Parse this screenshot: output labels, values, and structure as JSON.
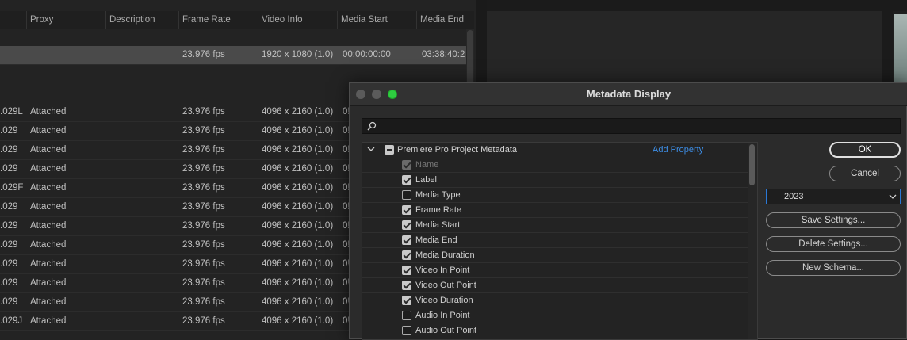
{
  "project_panel": {
    "columns": [
      "Proxy",
      "Description",
      "Frame Rate",
      "Video Info",
      "Media Start",
      "Media End"
    ],
    "selected_row": {
      "frame_rate": "23.976 fps",
      "video_info": "1920 x 1080 (1.0)",
      "media_start": "00:00:00:00",
      "media_end": "03:38:40:2"
    },
    "rows": [
      {
        "name": ".029L",
        "proxy": "Attached",
        "frame_rate": "23.976 fps",
        "video_info": "4096 x 2160 (1.0)",
        "start": "0!"
      },
      {
        "name": ".029",
        "proxy": "Attached",
        "frame_rate": "23.976 fps",
        "video_info": "4096 x 2160 (1.0)",
        "start": "0!"
      },
      {
        "name": ".029",
        "proxy": "Attached",
        "frame_rate": "23.976 fps",
        "video_info": "4096 x 2160 (1.0)",
        "start": "0!"
      },
      {
        "name": ".029",
        "proxy": "Attached",
        "frame_rate": "23.976 fps",
        "video_info": "4096 x 2160 (1.0)",
        "start": "0!"
      },
      {
        "name": ".029F",
        "proxy": "Attached",
        "frame_rate": "23.976 fps",
        "video_info": "4096 x 2160 (1.0)",
        "start": "0!"
      },
      {
        "name": ".029",
        "proxy": "Attached",
        "frame_rate": "23.976 fps",
        "video_info": "4096 x 2160 (1.0)",
        "start": "0!"
      },
      {
        "name": ".029",
        "proxy": "Attached",
        "frame_rate": "23.976 fps",
        "video_info": "4096 x 2160 (1.0)",
        "start": "0!"
      },
      {
        "name": ".029",
        "proxy": "Attached",
        "frame_rate": "23.976 fps",
        "video_info": "4096 x 2160 (1.0)",
        "start": "0!"
      },
      {
        "name": ".029",
        "proxy": "Attached",
        "frame_rate": "23.976 fps",
        "video_info": "4096 x 2160 (1.0)",
        "start": "0!"
      },
      {
        "name": ".029",
        "proxy": "Attached",
        "frame_rate": "23.976 fps",
        "video_info": "4096 x 2160 (1.0)",
        "start": "0!"
      },
      {
        "name": ".029",
        "proxy": "Attached",
        "frame_rate": "23.976 fps",
        "video_info": "4096 x 2160 (1.0)",
        "start": "0!"
      },
      {
        "name": ".029J",
        "proxy": "Attached",
        "frame_rate": "23.976 fps",
        "video_info": "4096 x 2160 (1.0)",
        "start": "0!"
      }
    ]
  },
  "dialog": {
    "title": "Metadata Display",
    "search_placeholder": "",
    "group_label": "Premiere Pro Project Metadata",
    "add_property": "Add Property",
    "properties": [
      {
        "label": "Name",
        "checked": true,
        "disabled": true
      },
      {
        "label": "Label",
        "checked": true,
        "disabled": false
      },
      {
        "label": "Media Type",
        "checked": false,
        "disabled": false
      },
      {
        "label": "Frame Rate",
        "checked": true,
        "disabled": false
      },
      {
        "label": "Media Start",
        "checked": true,
        "disabled": false
      },
      {
        "label": "Media End",
        "checked": true,
        "disabled": false
      },
      {
        "label": "Media Duration",
        "checked": true,
        "disabled": false
      },
      {
        "label": "Video In Point",
        "checked": true,
        "disabled": false
      },
      {
        "label": "Video Out Point",
        "checked": true,
        "disabled": false
      },
      {
        "label": "Video Duration",
        "checked": true,
        "disabled": false
      },
      {
        "label": "Audio In Point",
        "checked": false,
        "disabled": false
      },
      {
        "label": "Audio Out Point",
        "checked": false,
        "disabled": false
      }
    ],
    "ok_label": "OK",
    "cancel_label": "Cancel",
    "version_value": "2023",
    "save_label": "Save Settings...",
    "delete_label": "Delete Settings...",
    "new_schema_label": "New Schema..."
  }
}
